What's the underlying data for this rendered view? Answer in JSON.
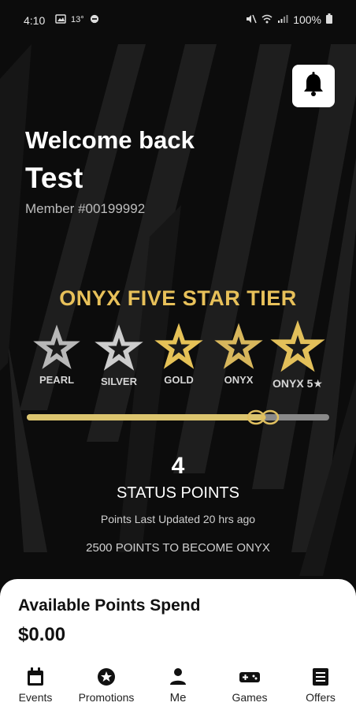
{
  "status_bar": {
    "time": "4:10",
    "left_icons": [
      "image-icon",
      "temperature-icon",
      "minus-circle-icon"
    ],
    "right_icons": [
      "mute-icon",
      "wifi-icon",
      "signal-icon"
    ],
    "battery": "100%"
  },
  "header": {
    "greeting": "Welcome back",
    "name": "Test",
    "member": "Member #00199992"
  },
  "tier": {
    "title": "ONYX FIVE STAR TIER",
    "levels": [
      {
        "label": "PEARL",
        "color": "#b8b8b8"
      },
      {
        "label": "SILVER",
        "color": "#c9c9c9"
      },
      {
        "label": "GOLD",
        "color": "#e6c257"
      },
      {
        "label": "ONYX",
        "color": "#d8b75c"
      },
      {
        "label": "ONYX 5★",
        "color": "#e3c05a"
      }
    ],
    "progress": 0.78
  },
  "points": {
    "value": "4",
    "label": "STATUS POINTS",
    "updated": "Points Last Updated 20 hrs ago",
    "to_next": "2500 POINTS TO BECOME ONYX"
  },
  "spend": {
    "title": "Available Points Spend",
    "amount": "$0.00"
  },
  "nav": {
    "events": "Events",
    "promotions": "Promotions",
    "me": "Me",
    "games": "Games",
    "offers": "Offers"
  },
  "colors": {
    "gold": "#e8c15a",
    "background": "#0c0c0c",
    "sheet": "#ffffff"
  }
}
